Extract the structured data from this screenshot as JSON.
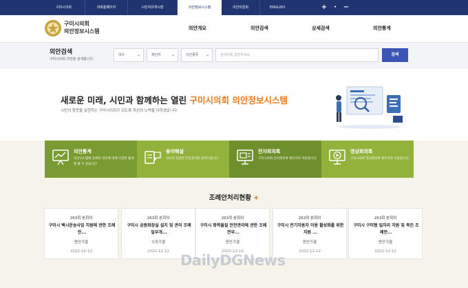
{
  "topbar": {
    "links": [
      "구미시의회",
      "의회홈페이지",
      "시민자유게시판",
      "의안정보시스템",
      "의안의원회",
      "ENGLISH"
    ],
    "zoom_in": "+",
    "zoom_dot": "•",
    "zoom_out": "−"
  },
  "header": {
    "logo_line1": "구미시의회",
    "logo_line2": "의안정보시스템",
    "nav": [
      "의안개요",
      "의안검색",
      "상세검색",
      "의안통계"
    ]
  },
  "search": {
    "title": "의안검색",
    "subtitle": "구미시의회 의안을 검색합니다.",
    "selects": [
      "대수",
      "제안자",
      "의안종류"
    ],
    "placeholder": "검색어를 입력하세요.",
    "button": "검색"
  },
  "hero": {
    "title_prefix": "새로운 미래, 시민과 함께하는 열린 ",
    "title_highlight": "구미시의회 의안정보시스템",
    "subtitle": "시민의 참뜻을 실현하는 구미시의회가 되도록 최선의 노력을 다하겠습니다."
  },
  "cards": [
    {
      "title": "의안통계",
      "desc": "의안시스템에 등록된 의안에 대해 다양한 통계를 볼 수 있습니다.",
      "color": "#7a9a32",
      "icon": "chart-board-icon"
    },
    {
      "title": "용어해설",
      "desc": "의안과 관련된 전문용어를 알려드립니다.",
      "color": "#93b23c",
      "icon": "dictionary-icon"
    },
    {
      "title": "전자회의록",
      "desc": "구미시의회 전자회의록 페이지로 이동합니다.",
      "color": "#6f8e2c",
      "icon": "monitor-icon"
    },
    {
      "title": "영상회의록",
      "desc": "구미시의회 영상회의록 페이지로 이동합니다.",
      "color": "#93b23c",
      "icon": "video-icon"
    }
  ],
  "section_title": "조례안처리현황",
  "section_plus": "+",
  "minutes": [
    {
      "session": "263회 본회의",
      "title": "구미시 택시운송사업 지원에 관한 조례안...",
      "status": "원안가결",
      "date": "2022-12-12"
    },
    {
      "session": "263회 본회의",
      "title": "구미시 공중화장실 설치 및 관리 조례 일부개...",
      "status": "수정가결",
      "date": "2022-12-12"
    },
    {
      "session": "263회 본회의",
      "title": "구미시 화학물질 안전관리에 관한 조례 전부...",
      "status": "원안가결",
      "date": "2022-12-12"
    },
    {
      "session": "263회 본회의",
      "title": "구미시 전기자동차 이용 활성화를 위한 지원 ...",
      "status": "원안가결",
      "date": "2022-12-12"
    },
    {
      "session": "263회 본회의",
      "title": "구미시 구미형 일자리 지원 및 촉진 조례안...",
      "status": "원안가결",
      "date": "2022-12-12"
    }
  ],
  "watermark": "DailyDGNews",
  "colors": {
    "navy": "#1f3470",
    "search_button": "#3a55b4",
    "highlight": "#ec7a1c"
  }
}
